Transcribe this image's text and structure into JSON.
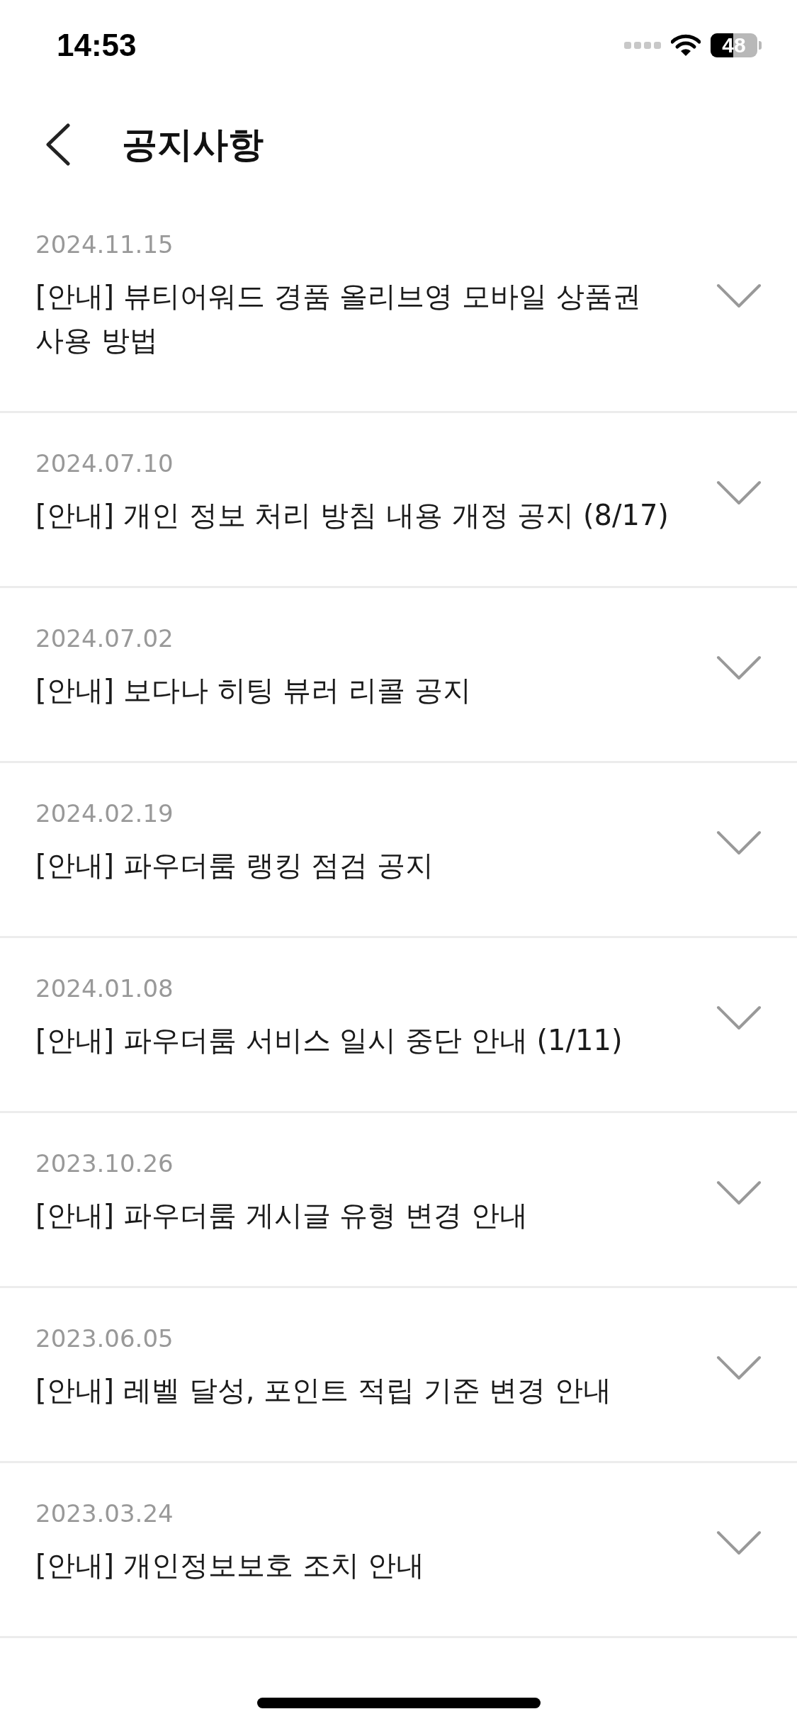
{
  "status_bar": {
    "time": "14:53",
    "battery": "48"
  },
  "header": {
    "title": "공지사항"
  },
  "notices": [
    {
      "date": "2024.11.15",
      "title": "[안내] 뷰티어워드 경품 올리브영 모바일 상품권 사용 방법",
      "expanded": false
    },
    {
      "date": "2024.07.10",
      "title": "[안내] 개인 정보 처리 방침 내용 개정 공지 (8/17)",
      "expanded": false
    },
    {
      "date": "2024.07.02",
      "title": "[안내] 보다나 히팅 뷰러 리콜 공지",
      "expanded": false
    },
    {
      "date": "2024.02.19",
      "title": "[안내] 파우더룸 랭킹 점검 공지",
      "expanded": false
    },
    {
      "date": "2024.01.08",
      "title": "[안내] 파우더룸 서비스 일시 중단 안내 (1/11)",
      "expanded": false
    },
    {
      "date": "2023.10.26",
      "title": "[안내] 파우더룸 게시글 유형 변경 안내",
      "expanded": false
    },
    {
      "date": "2023.06.05",
      "title": "[안내] 레벨 달성, 포인트 적립 기준 변경 안내",
      "expanded": false
    },
    {
      "date": "2023.03.24",
      "title": "[안내] 개인정보보호 조치 안내",
      "expanded": false
    }
  ]
}
